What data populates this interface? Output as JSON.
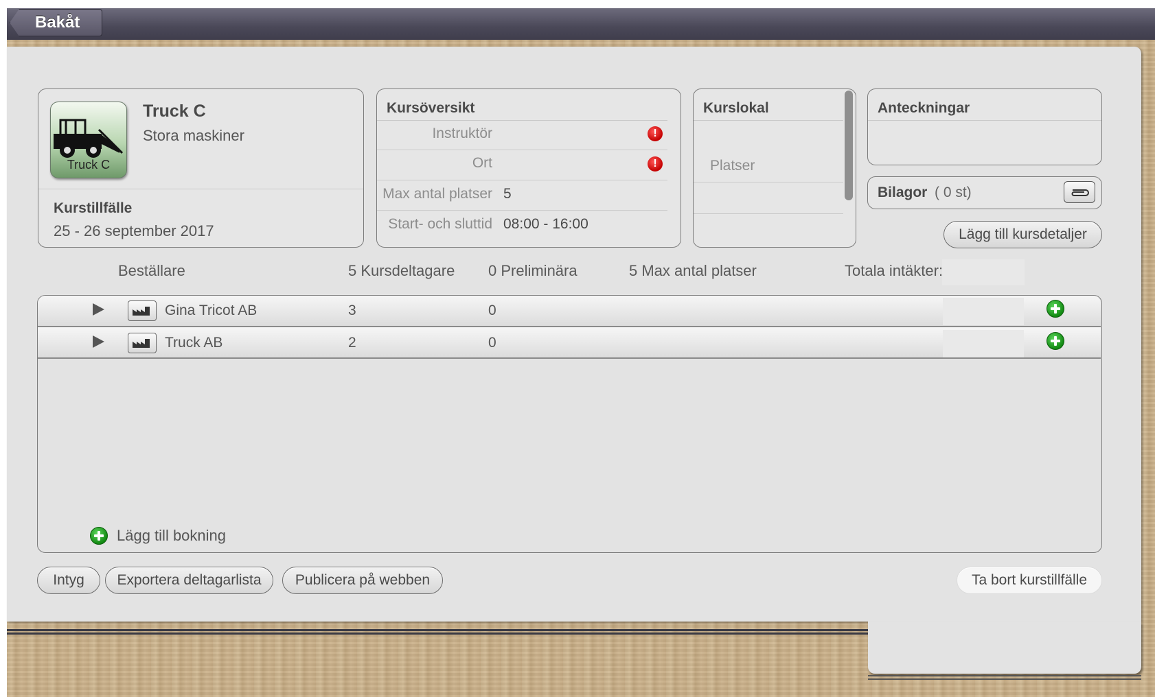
{
  "nav": {
    "back_label": "Bakåt"
  },
  "course": {
    "name": "Truck C",
    "category": "Stora maskiner",
    "icon_caption": "Truck C",
    "occasion_label": "Kurstillfälle",
    "occasion_dates": "25 - 26 september 2017"
  },
  "overview": {
    "title": "Kursöversikt",
    "rows": [
      {
        "label": "Instruktör",
        "value": ""
      },
      {
        "label": "Ort",
        "value": ""
      },
      {
        "label": "Max antal platser",
        "value": "5"
      },
      {
        "label": "Start- och sluttid",
        "value": "08:00 - 16:00"
      }
    ]
  },
  "venue": {
    "title": "Kurslokal",
    "seats_label": "Platser"
  },
  "notes": {
    "title": "Anteckningar"
  },
  "attachments": {
    "label": "Bilagor",
    "count": "( 0 st)"
  },
  "add_details_button": "Lägg till kursdetaljer",
  "table": {
    "headers": {
      "orderer": "Beställare",
      "participants": "5 Kursdeltagare",
      "preliminary": "0 Preliminära",
      "max_seats": "5 Max antal platser",
      "total_income": "Totala intäkter:"
    },
    "rows": [
      {
        "company": "Gina Tricot AB",
        "participants": "3",
        "preliminary": "0"
      },
      {
        "company": "Truck AB",
        "participants": "2",
        "preliminary": "0"
      }
    ],
    "add_booking": "Lägg till bokning"
  },
  "footer": {
    "certificate": "Intyg",
    "export": "Exportera deltagarlista",
    "publish": "Publicera på webben",
    "delete": "Ta bort kurstillfälle"
  },
  "colors": {
    "accent_green": "#138a13",
    "error_red": "#c40000",
    "topbar": "#4a4858"
  }
}
